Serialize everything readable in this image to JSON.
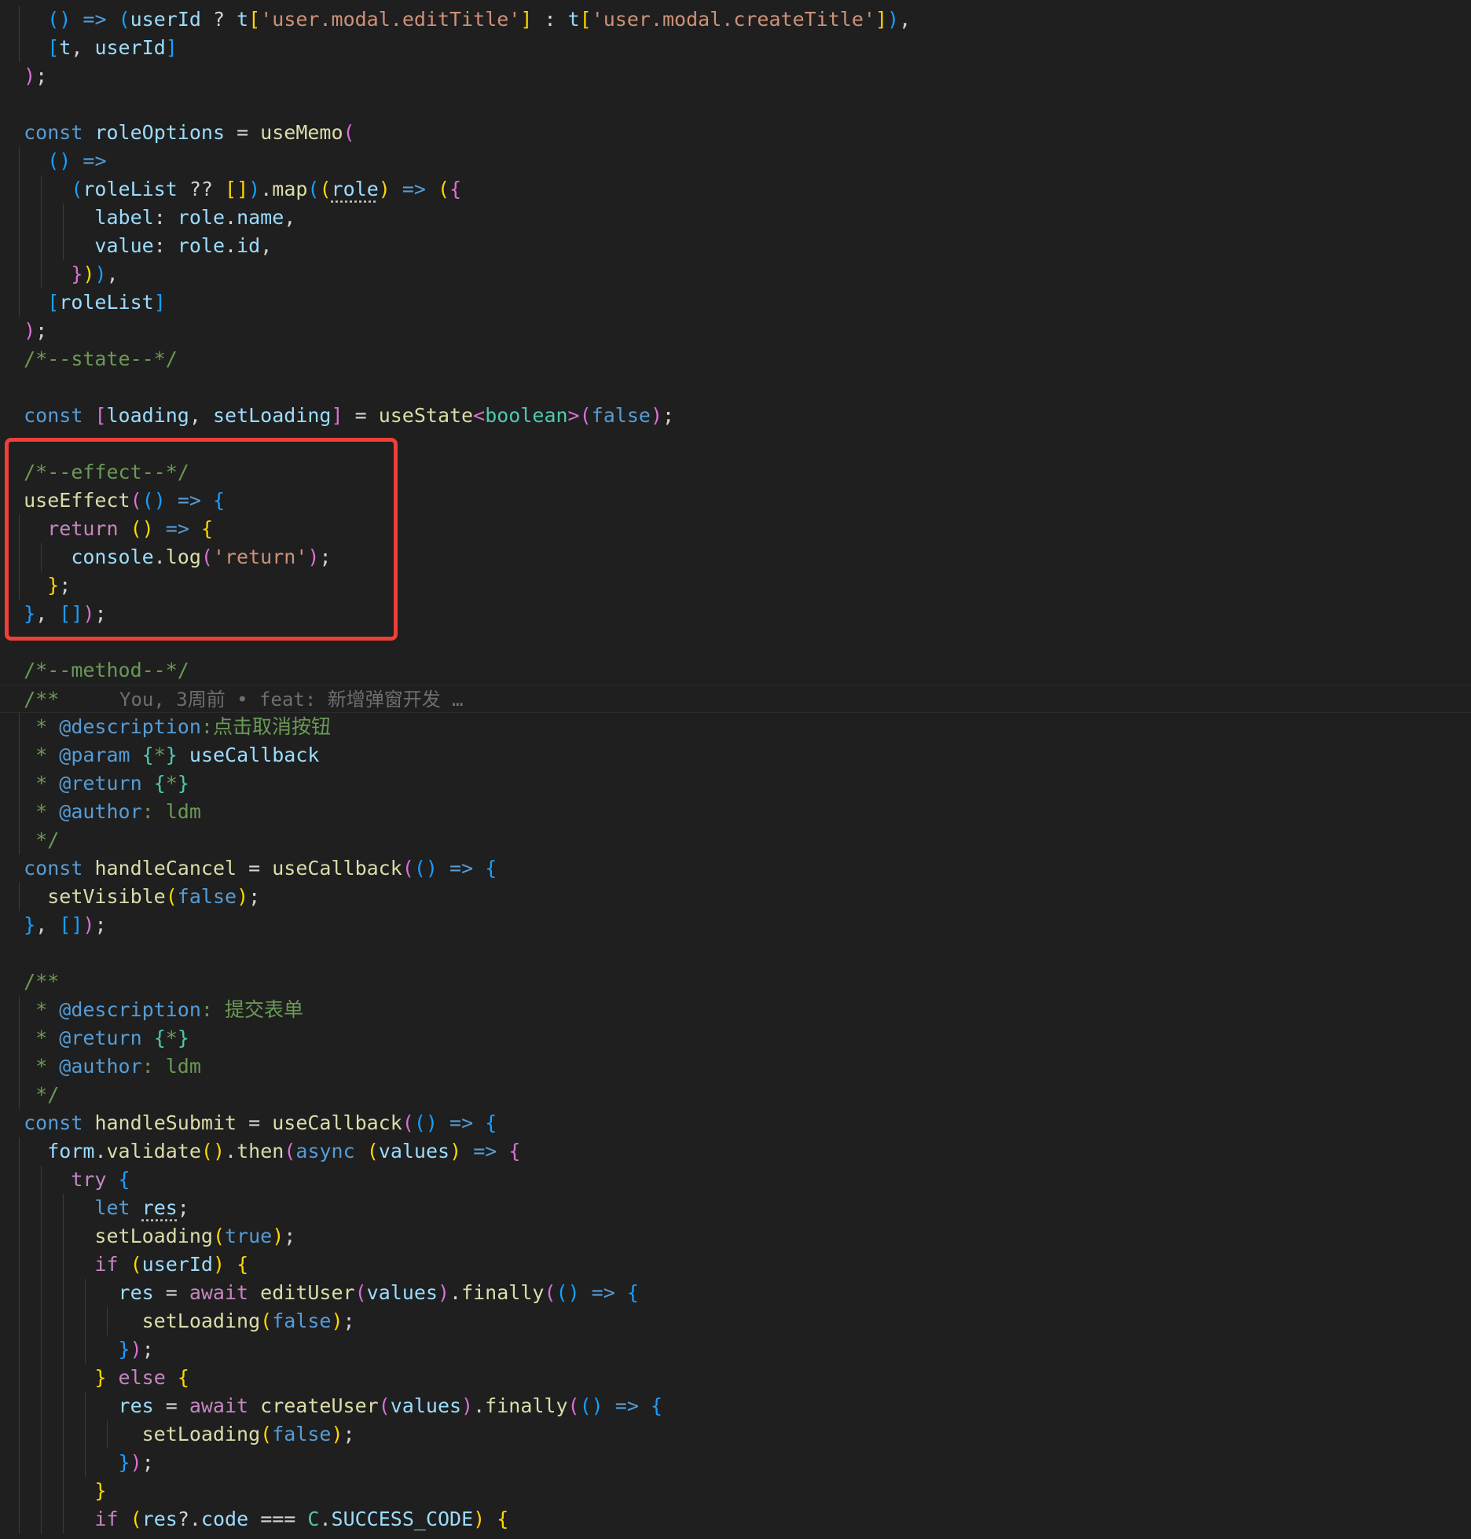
{
  "editor": {
    "language": "tsx",
    "annotation": {
      "type": "highlight-box",
      "color": "#ee3f38"
    },
    "colors": {
      "background": "#1f1f1f",
      "keyword": "#569cd6",
      "variable": "#9cdcfe",
      "function": "#dcdcaa",
      "string": "#ce9178",
      "comment": "#6a9955",
      "control": "#c586c0",
      "type": "#4ec9b0",
      "bracket1": "#ffd700",
      "bracket2": "#da70d6",
      "bracket3": "#179fff",
      "text": "#d4d4d4"
    },
    "blame": {
      "text": "You, 3周前 • feat: 新增弹窗开发 …"
    },
    "lines": [
      [
        [
          "    ",
          "t"
        ],
        [
          "(",
          "b3"
        ],
        [
          ")",
          "b3"
        ],
        [
          " => ",
          "k"
        ],
        [
          "(",
          "b3"
        ],
        [
          "userId",
          "v"
        ],
        [
          " ? ",
          "t"
        ],
        [
          "t",
          "v"
        ],
        [
          "[",
          "b1"
        ],
        [
          "'user.modal.editTitle'",
          "s"
        ],
        [
          "]",
          "b1"
        ],
        [
          " : ",
          "t"
        ],
        [
          "t",
          "v"
        ],
        [
          "[",
          "b1"
        ],
        [
          "'user.modal.createTitle'",
          "s"
        ],
        [
          "]",
          "b1"
        ],
        [
          ")",
          "b3"
        ],
        [
          ",",
          "t"
        ]
      ],
      [
        [
          "    ",
          "t"
        ],
        [
          "[",
          "b3"
        ],
        [
          "t",
          "v"
        ],
        [
          ", ",
          "t"
        ],
        [
          "userId",
          "v"
        ],
        [
          "]",
          "b3"
        ]
      ],
      [
        [
          "  ",
          "t"
        ],
        [
          ")",
          "b2"
        ],
        [
          ";",
          "t"
        ]
      ],
      [],
      [
        [
          "  ",
          "t"
        ],
        [
          "const",
          "k"
        ],
        [
          " ",
          "t"
        ],
        [
          "roleOptions",
          "v"
        ],
        [
          " = ",
          "t"
        ],
        [
          "useMemo",
          "f"
        ],
        [
          "(",
          "b2"
        ]
      ],
      [
        [
          "    ",
          "t"
        ],
        [
          "(",
          "b3"
        ],
        [
          ")",
          "b3"
        ],
        [
          " =>",
          "k"
        ]
      ],
      [
        [
          "      ",
          "t"
        ],
        [
          "(",
          "b3"
        ],
        [
          "roleList",
          "v"
        ],
        [
          " ?? ",
          "t"
        ],
        [
          "[",
          "b1"
        ],
        [
          "]",
          "b1"
        ],
        [
          ")",
          "b3"
        ],
        [
          ".",
          "t"
        ],
        [
          "map",
          "f"
        ],
        [
          "(",
          "b3"
        ],
        [
          "(",
          "b1"
        ],
        [
          "role",
          "v"
        ],
        [
          ")",
          "b1"
        ],
        [
          " => ",
          "k"
        ],
        [
          "(",
          "b1"
        ],
        [
          "{",
          "b2"
        ]
      ],
      [
        [
          "        ",
          "t"
        ],
        [
          "label",
          "v"
        ],
        [
          ": ",
          "t"
        ],
        [
          "role",
          "v"
        ],
        [
          ".",
          "t"
        ],
        [
          "name",
          "v"
        ],
        [
          ",",
          "t"
        ]
      ],
      [
        [
          "        ",
          "t"
        ],
        [
          "value",
          "v"
        ],
        [
          ": ",
          "t"
        ],
        [
          "role",
          "v"
        ],
        [
          ".",
          "t"
        ],
        [
          "id",
          "v"
        ],
        [
          ",",
          "t"
        ]
      ],
      [
        [
          "      ",
          "t"
        ],
        [
          "}",
          "b2"
        ],
        [
          ")",
          "b1"
        ],
        [
          ")",
          "b3"
        ],
        [
          ",",
          "t"
        ]
      ],
      [
        [
          "    ",
          "t"
        ],
        [
          "[",
          "b3"
        ],
        [
          "roleList",
          "v"
        ],
        [
          "]",
          "b3"
        ]
      ],
      [
        [
          "  ",
          "t"
        ],
        [
          ")",
          "b2"
        ],
        [
          ";",
          "t"
        ]
      ],
      [
        [
          "  ",
          "t"
        ],
        [
          "/*--state--*/",
          "c"
        ]
      ],
      [],
      [
        [
          "  ",
          "t"
        ],
        [
          "const",
          "k"
        ],
        [
          " ",
          "t"
        ],
        [
          "[",
          "b2"
        ],
        [
          "loading",
          "v"
        ],
        [
          ", ",
          "t"
        ],
        [
          "setLoading",
          "v"
        ],
        [
          "]",
          "b2"
        ],
        [
          " = ",
          "t"
        ],
        [
          "useState",
          "f"
        ],
        [
          "<",
          "b2"
        ],
        [
          "boolean",
          "ty"
        ],
        [
          ">",
          "b2"
        ],
        [
          "(",
          "b2"
        ],
        [
          "false",
          "k"
        ],
        [
          ")",
          "b2"
        ],
        [
          ";",
          "t"
        ]
      ],
      [],
      [
        [
          "  ",
          "t"
        ],
        [
          "/*--effect--*/",
          "c"
        ]
      ],
      [
        [
          "  ",
          "t"
        ],
        [
          "useEffect",
          "f"
        ],
        [
          "(",
          "b2"
        ],
        [
          "(",
          "b3"
        ],
        [
          ")",
          "b3"
        ],
        [
          " => ",
          "k"
        ],
        [
          "{",
          "b3"
        ]
      ],
      [
        [
          "    ",
          "t"
        ],
        [
          "return",
          "ctl"
        ],
        [
          " ",
          "t"
        ],
        [
          "(",
          "b1"
        ],
        [
          ")",
          "b1"
        ],
        [
          " => ",
          "k"
        ],
        [
          "{",
          "b1"
        ]
      ],
      [
        [
          "      ",
          "t"
        ],
        [
          "console",
          "v"
        ],
        [
          ".",
          "t"
        ],
        [
          "log",
          "f"
        ],
        [
          "(",
          "b2"
        ],
        [
          "'return'",
          "s"
        ],
        [
          ")",
          "b2"
        ],
        [
          ";",
          "t"
        ]
      ],
      [
        [
          "    ",
          "t"
        ],
        [
          "}",
          "b1"
        ],
        [
          ";",
          "t"
        ]
      ],
      [
        [
          "  ",
          "t"
        ],
        [
          "}",
          "b3"
        ],
        [
          ", ",
          "t"
        ],
        [
          "[",
          "b3"
        ],
        [
          "]",
          "b3"
        ],
        [
          ")",
          "b2"
        ],
        [
          ";",
          "t"
        ]
      ],
      [],
      [
        [
          "  ",
          "t"
        ],
        [
          "/*--method--*/",
          "c"
        ]
      ],
      [
        [
          "  ",
          "t"
        ],
        [
          "/**",
          "c"
        ]
      ],
      [
        [
          "   ",
          "t"
        ],
        [
          "* ",
          "c"
        ],
        [
          "@description",
          "k"
        ],
        [
          ":点击取消按钮",
          "c"
        ]
      ],
      [
        [
          "   ",
          "t"
        ],
        [
          "* ",
          "c"
        ],
        [
          "@param",
          "k"
        ],
        [
          " ",
          "t"
        ],
        [
          "{",
          "ty"
        ],
        [
          "*",
          "c"
        ],
        [
          "}",
          "ty"
        ],
        [
          " ",
          "t"
        ],
        [
          "useCallback",
          "v"
        ]
      ],
      [
        [
          "   ",
          "t"
        ],
        [
          "* ",
          "c"
        ],
        [
          "@return",
          "k"
        ],
        [
          " ",
          "t"
        ],
        [
          "{",
          "ty"
        ],
        [
          "*",
          "c"
        ],
        [
          "}",
          "ty"
        ]
      ],
      [
        [
          "   ",
          "t"
        ],
        [
          "* ",
          "c"
        ],
        [
          "@author",
          "k"
        ],
        [
          ": ldm",
          "c"
        ]
      ],
      [
        [
          "   ",
          "t"
        ],
        [
          "*/",
          "c"
        ]
      ],
      [
        [
          "  ",
          "t"
        ],
        [
          "const",
          "k"
        ],
        [
          " ",
          "t"
        ],
        [
          "handleCancel",
          "f"
        ],
        [
          " = ",
          "t"
        ],
        [
          "useCallback",
          "f"
        ],
        [
          "(",
          "b2"
        ],
        [
          "(",
          "b3"
        ],
        [
          ")",
          "b3"
        ],
        [
          " => ",
          "k"
        ],
        [
          "{",
          "b3"
        ]
      ],
      [
        [
          "    ",
          "t"
        ],
        [
          "setVisible",
          "f"
        ],
        [
          "(",
          "b1"
        ],
        [
          "false",
          "k"
        ],
        [
          ")",
          "b1"
        ],
        [
          ";",
          "t"
        ]
      ],
      [
        [
          "  ",
          "t"
        ],
        [
          "}",
          "b3"
        ],
        [
          ", ",
          "t"
        ],
        [
          "[",
          "b3"
        ],
        [
          "]",
          "b3"
        ],
        [
          ")",
          "b2"
        ],
        [
          ";",
          "t"
        ]
      ],
      [],
      [
        [
          "  ",
          "t"
        ],
        [
          "/**",
          "c"
        ]
      ],
      [
        [
          "   ",
          "t"
        ],
        [
          "* ",
          "c"
        ],
        [
          "@description",
          "k"
        ],
        [
          ": 提交表单",
          "c"
        ]
      ],
      [
        [
          "   ",
          "t"
        ],
        [
          "* ",
          "c"
        ],
        [
          "@return",
          "k"
        ],
        [
          " ",
          "t"
        ],
        [
          "{",
          "ty"
        ],
        [
          "*",
          "c"
        ],
        [
          "}",
          "ty"
        ]
      ],
      [
        [
          "   ",
          "t"
        ],
        [
          "* ",
          "c"
        ],
        [
          "@author",
          "k"
        ],
        [
          ": ldm",
          "c"
        ]
      ],
      [
        [
          "   ",
          "t"
        ],
        [
          "*/",
          "c"
        ]
      ],
      [
        [
          "  ",
          "t"
        ],
        [
          "const",
          "k"
        ],
        [
          " ",
          "t"
        ],
        [
          "handleSubmit",
          "f"
        ],
        [
          " = ",
          "t"
        ],
        [
          "useCallback",
          "f"
        ],
        [
          "(",
          "b2"
        ],
        [
          "(",
          "b3"
        ],
        [
          ")",
          "b3"
        ],
        [
          " => ",
          "k"
        ],
        [
          "{",
          "b3"
        ]
      ],
      [
        [
          "    ",
          "t"
        ],
        [
          "form",
          "v"
        ],
        [
          ".",
          "t"
        ],
        [
          "validate",
          "f"
        ],
        [
          "(",
          "b1"
        ],
        [
          ")",
          "b1"
        ],
        [
          ".",
          "t"
        ],
        [
          "then",
          "f"
        ],
        [
          "(",
          "b2"
        ],
        [
          "async",
          "k"
        ],
        [
          " ",
          "t"
        ],
        [
          "(",
          "b1"
        ],
        [
          "values",
          "v"
        ],
        [
          ")",
          "b1"
        ],
        [
          " => ",
          "k"
        ],
        [
          "{",
          "b2"
        ]
      ],
      [
        [
          "      ",
          "t"
        ],
        [
          "try",
          "ctl"
        ],
        [
          " ",
          "t"
        ],
        [
          "{",
          "b3"
        ]
      ],
      [
        [
          "        ",
          "t"
        ],
        [
          "let",
          "k"
        ],
        [
          " ",
          "t"
        ],
        [
          "res",
          "v"
        ],
        [
          ";",
          "t"
        ]
      ],
      [
        [
          "        ",
          "t"
        ],
        [
          "setLoading",
          "f"
        ],
        [
          "(",
          "b1"
        ],
        [
          "true",
          "k"
        ],
        [
          ")",
          "b1"
        ],
        [
          ";",
          "t"
        ]
      ],
      [
        [
          "        ",
          "t"
        ],
        [
          "if",
          "ctl"
        ],
        [
          " ",
          "t"
        ],
        [
          "(",
          "b1"
        ],
        [
          "userId",
          "v"
        ],
        [
          ")",
          "b1"
        ],
        [
          " ",
          "t"
        ],
        [
          "{",
          "b1"
        ]
      ],
      [
        [
          "          ",
          "t"
        ],
        [
          "res",
          "v"
        ],
        [
          " = ",
          "t"
        ],
        [
          "await",
          "ctl"
        ],
        [
          " ",
          "t"
        ],
        [
          "editUser",
          "f"
        ],
        [
          "(",
          "b2"
        ],
        [
          "values",
          "v"
        ],
        [
          ")",
          "b2"
        ],
        [
          ".",
          "t"
        ],
        [
          "finally",
          "f"
        ],
        [
          "(",
          "b2"
        ],
        [
          "(",
          "b3"
        ],
        [
          ")",
          "b3"
        ],
        [
          " => ",
          "k"
        ],
        [
          "{",
          "b3"
        ]
      ],
      [
        [
          "            ",
          "t"
        ],
        [
          "setLoading",
          "f"
        ],
        [
          "(",
          "b1"
        ],
        [
          "false",
          "k"
        ],
        [
          ")",
          "b1"
        ],
        [
          ";",
          "t"
        ]
      ],
      [
        [
          "          ",
          "t"
        ],
        [
          "}",
          "b3"
        ],
        [
          ")",
          "b2"
        ],
        [
          ";",
          "t"
        ]
      ],
      [
        [
          "        ",
          "t"
        ],
        [
          "}",
          "b1"
        ],
        [
          " ",
          "t"
        ],
        [
          "else",
          "ctl"
        ],
        [
          " ",
          "t"
        ],
        [
          "{",
          "b1"
        ]
      ],
      [
        [
          "          ",
          "t"
        ],
        [
          "res",
          "v"
        ],
        [
          " = ",
          "t"
        ],
        [
          "await",
          "ctl"
        ],
        [
          " ",
          "t"
        ],
        [
          "createUser",
          "f"
        ],
        [
          "(",
          "b2"
        ],
        [
          "values",
          "v"
        ],
        [
          ")",
          "b2"
        ],
        [
          ".",
          "t"
        ],
        [
          "finally",
          "f"
        ],
        [
          "(",
          "b2"
        ],
        [
          "(",
          "b3"
        ],
        [
          ")",
          "b3"
        ],
        [
          " => ",
          "k"
        ],
        [
          "{",
          "b3"
        ]
      ],
      [
        [
          "            ",
          "t"
        ],
        [
          "setLoading",
          "f"
        ],
        [
          "(",
          "b1"
        ],
        [
          "false",
          "k"
        ],
        [
          ")",
          "b1"
        ],
        [
          ";",
          "t"
        ]
      ],
      [
        [
          "          ",
          "t"
        ],
        [
          "}",
          "b3"
        ],
        [
          ")",
          "b2"
        ],
        [
          ";",
          "t"
        ]
      ],
      [
        [
          "        ",
          "t"
        ],
        [
          "}",
          "b1"
        ]
      ],
      [
        [
          "        ",
          "t"
        ],
        [
          "if",
          "ctl"
        ],
        [
          " ",
          "t"
        ],
        [
          "(",
          "b1"
        ],
        [
          "res",
          "v"
        ],
        [
          "?.",
          "t"
        ],
        [
          "code",
          "v"
        ],
        [
          " === ",
          "t"
        ],
        [
          "C",
          "ty"
        ],
        [
          ".",
          "t"
        ],
        [
          "SUCCESS_CODE",
          "v"
        ],
        [
          ")",
          "b1"
        ],
        [
          " ",
          "t"
        ],
        [
          "{",
          "b1"
        ]
      ]
    ]
  }
}
